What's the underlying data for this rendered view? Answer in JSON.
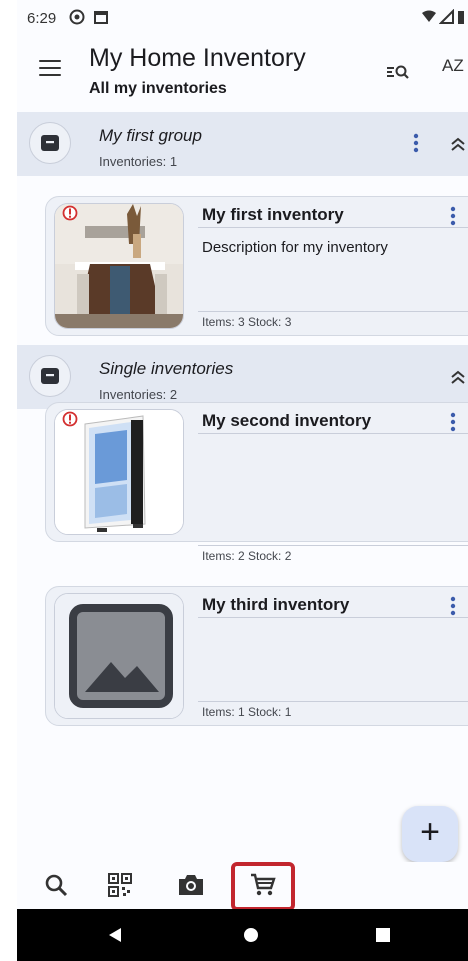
{
  "status_bar": {
    "time": "6:29"
  },
  "app_bar": {
    "title": "My Home Inventory",
    "subtitle": "All my inventories",
    "sort_label": "AZ"
  },
  "groups": [
    {
      "title": "My first group",
      "count_label": "Inventories: 1",
      "inventories": [
        {
          "title": "My first inventory",
          "description": "Description for my inventory",
          "meta": "Items: 3   Stock: 3",
          "image": "dining-room-photo",
          "warning": true
        }
      ]
    },
    {
      "title": "Single inventories",
      "count_label": "Inventories: 2",
      "inventories": [
        {
          "title": "My second inventory",
          "description": "",
          "meta": "Items: 2   Stock: 2",
          "image": "pc-case-photo",
          "warning": true
        },
        {
          "title": "My third inventory",
          "description": "",
          "meta": "Items: 1   Stock: 1",
          "image": "placeholder-image-icon",
          "warning": false
        }
      ]
    }
  ],
  "fab": {
    "label": "+"
  },
  "bottom_nav": [
    "search-icon",
    "qr-code-icon",
    "camera-icon",
    "shopping-cart-icon"
  ],
  "colors": {
    "highlight": "#c2262e",
    "group_bg": "#e3e8f2",
    "card_bg": "#eef1f7",
    "accent": "#3b5bab",
    "warning": "#d32f2f"
  }
}
